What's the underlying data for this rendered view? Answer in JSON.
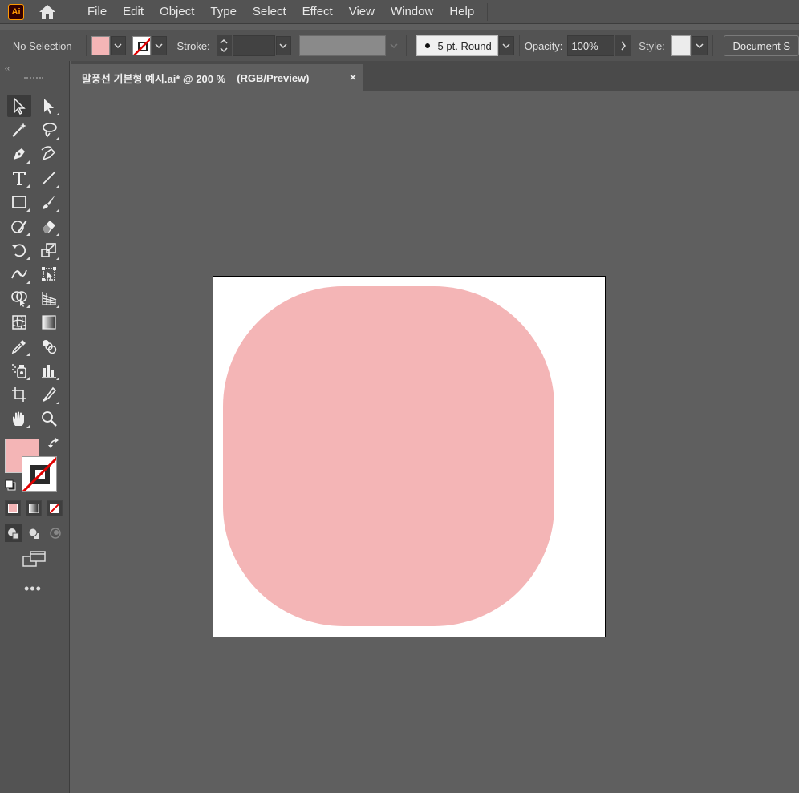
{
  "app": {
    "logo_text": "Ai",
    "menu": [
      "File",
      "Edit",
      "Object",
      "Type",
      "Select",
      "Effect",
      "View",
      "Window",
      "Help"
    ]
  },
  "control_bar": {
    "selection_status": "No Selection",
    "fill_color": "#f4b5b6",
    "stroke_label": "Stroke:",
    "brush_label": "5 pt. Round",
    "opacity_label": "Opacity:",
    "opacity_value": "100%",
    "style_label": "Style:",
    "document_button": "Document S"
  },
  "document_tab": {
    "name": "말풍선 기본형 예시.ai* @ 200 %",
    "mode": "(RGB/Preview)",
    "close": "×"
  },
  "tools_panel": {
    "collapse": "‹‹",
    "more": "•••",
    "fill_color": "#f4b5b6"
  },
  "artwork": {
    "shape": "rounded-rectangle",
    "fill": "#f4b5b6",
    "artboard_color": "#ffffff"
  }
}
